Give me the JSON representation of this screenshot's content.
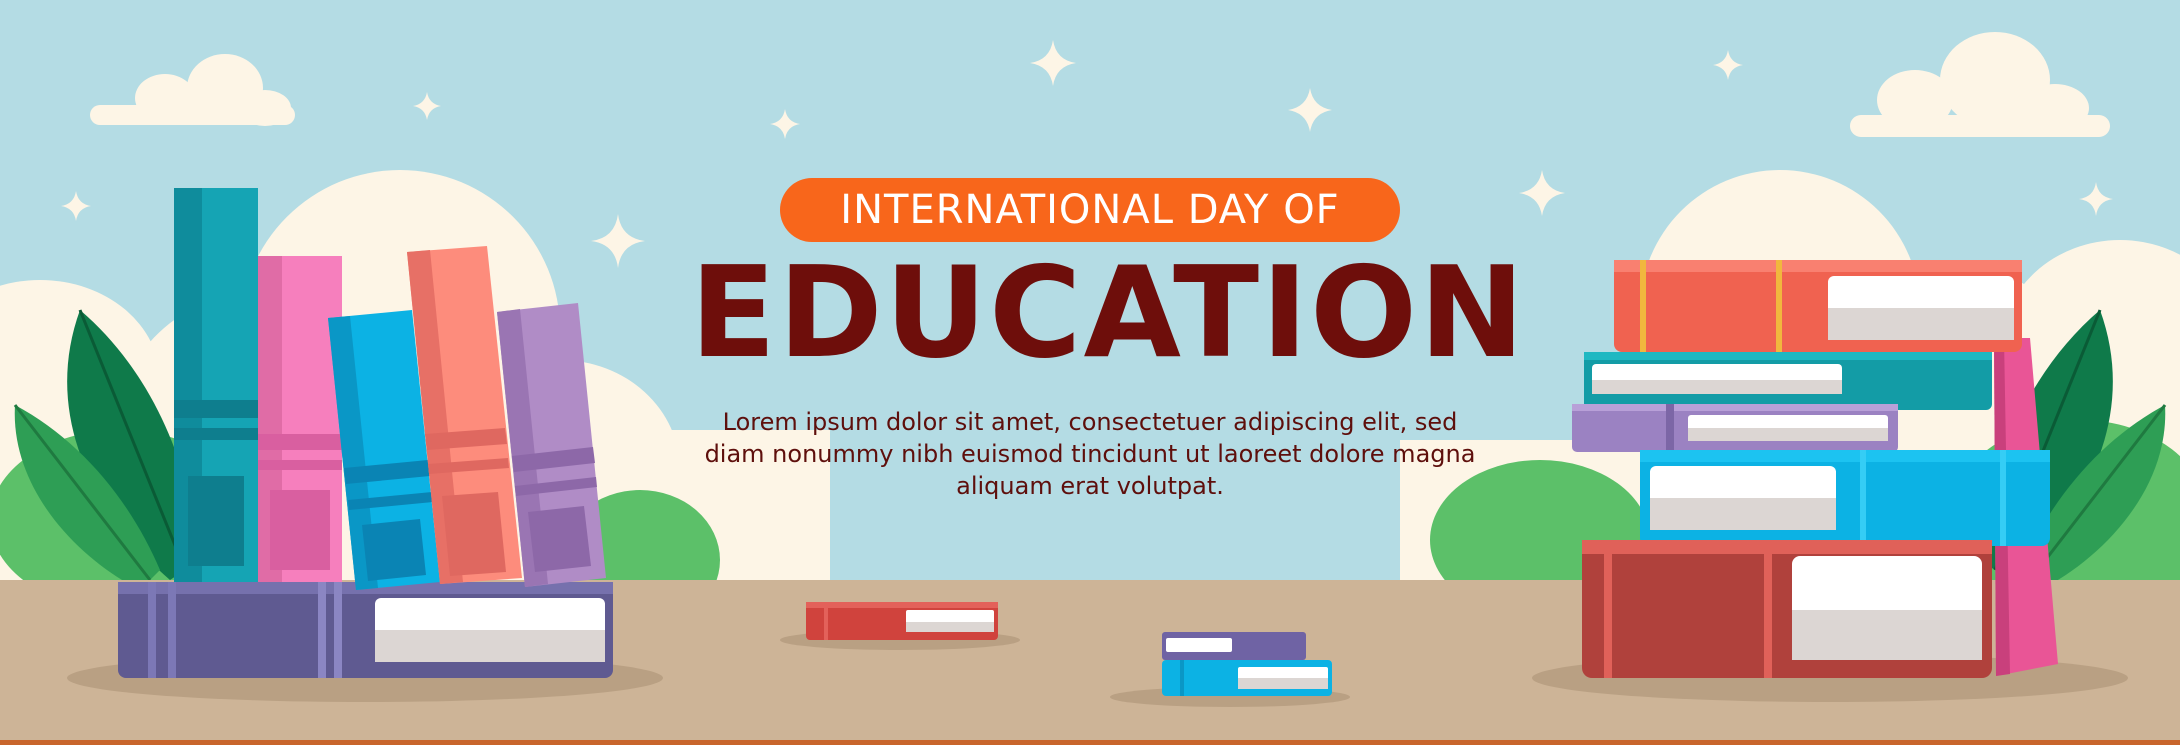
{
  "banner": {
    "badge_text": "INTERNATIONAL DAY OF",
    "title": "EDUCATION",
    "description": "Lorem ipsum dolor sit amet, consectetuer adipiscing elit, sed diam nonummy nibh euismod tincidunt ut laoreet dolore magna aliquam erat volutpat."
  },
  "colors": {
    "sky": "#b4dce4",
    "table": "#cdb497",
    "badge": "#f8661b",
    "title": "#6e0e0b",
    "cloud": "#fdf5e6",
    "leaf_dark": "#0f7a4a",
    "leaf_light": "#5cc069"
  },
  "icons": [
    "sparkle-icon",
    "cloud-icon",
    "leaf-icon",
    "book-icon"
  ]
}
